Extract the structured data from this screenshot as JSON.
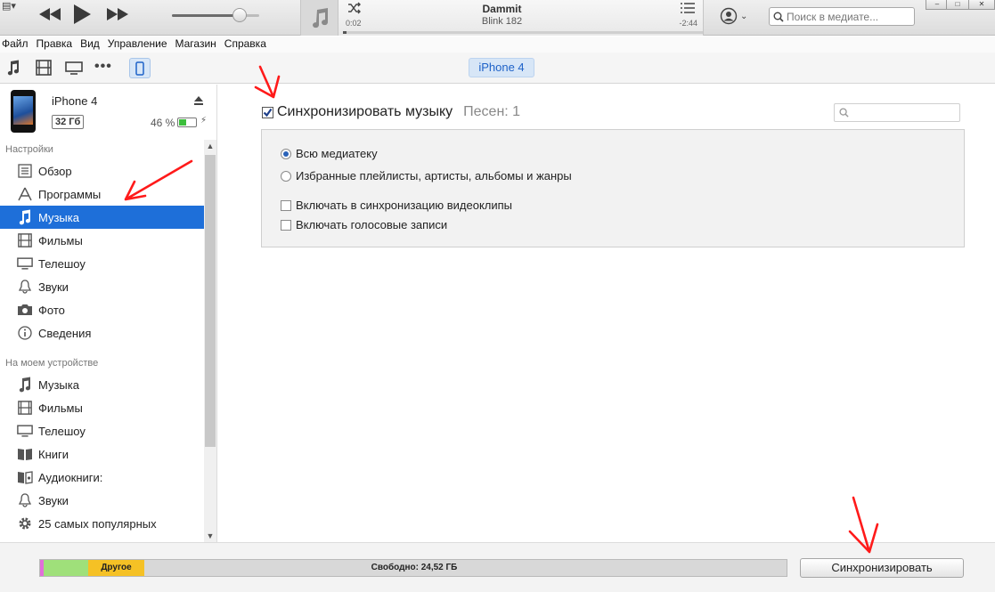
{
  "player": {
    "title": "Dammit",
    "artist": "Blink 182",
    "elapsed": "0:02",
    "remaining": "-2:44",
    "progress_fraction": 0.01,
    "volume_fraction": 0.78
  },
  "search": {
    "placeholder": "Поиск в медиате..."
  },
  "menu": [
    "Файл",
    "Правка",
    "Вид",
    "Управление",
    "Магазин",
    "Справка"
  ],
  "kinds": {
    "icons": [
      "music-note-icon",
      "film-icon",
      "tv-icon",
      "more-icon",
      "iphone-icon"
    ],
    "device_tab": "iPhone 4"
  },
  "device": {
    "name": "iPhone 4",
    "capacity": "32 Гб",
    "battery": "46 %",
    "battery_fraction": 0.46
  },
  "sidebar": {
    "settings_label": "Настройки",
    "settings_items": [
      {
        "label": "Обзор",
        "icon": "summary-icon"
      },
      {
        "label": "Программы",
        "icon": "apps-icon"
      },
      {
        "label": "Музыка",
        "icon": "music-note-icon",
        "selected": true
      },
      {
        "label": "Фильмы",
        "icon": "film-icon"
      },
      {
        "label": "Телешоу",
        "icon": "tv-icon"
      },
      {
        "label": "Звуки",
        "icon": "bell-icon"
      },
      {
        "label": "Фото",
        "icon": "camera-icon"
      },
      {
        "label": "Сведения",
        "icon": "info-icon"
      }
    ],
    "device_label": "На моем устройстве",
    "device_items": [
      {
        "label": "Музыка",
        "icon": "music-note-icon"
      },
      {
        "label": "Фильмы",
        "icon": "film-icon"
      },
      {
        "label": "Телешоу",
        "icon": "tv-icon"
      },
      {
        "label": "Книги",
        "icon": "book-icon"
      },
      {
        "label": "Аудиокниги:",
        "icon": "audiobook-icon"
      },
      {
        "label": "Звуки",
        "icon": "bell-icon"
      },
      {
        "label": "25 самых популярных",
        "icon": "gear-icon"
      }
    ]
  },
  "main": {
    "sync_label": "Синхронизировать музыку",
    "sync_checked": true,
    "song_count": "Песен: 1",
    "options": {
      "entire_library": "Всю медиатеку",
      "selected": "Избранные плейлисты, артисты, альбомы и жанры",
      "include_videos": "Включать в синхронизацию видеоклипы",
      "include_voice": "Включать голосовые записи"
    }
  },
  "storage": {
    "other_label": "Другое",
    "free_label": "Свободно: 24,52 ГБ",
    "colors": {
      "pink": "#e26fd9",
      "green": "#9fe07a",
      "other": "#f5c125",
      "free": "#d8d8d8"
    }
  },
  "sync_button": "Синхронизировать"
}
